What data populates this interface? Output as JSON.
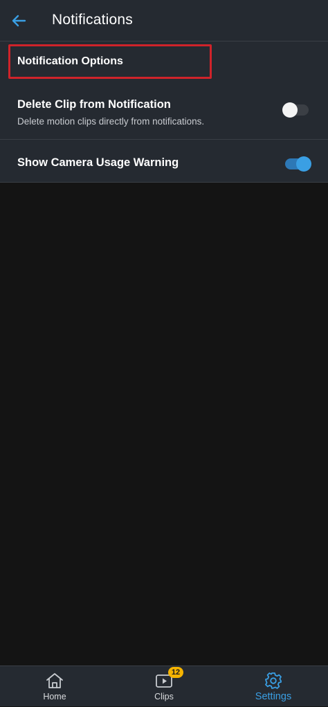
{
  "app_bar": {
    "title": "Notifications",
    "back_icon": "arrow-left-icon",
    "accent_color": "#3a9fe4"
  },
  "section": {
    "header": "Notification Options",
    "highlight_color": "#d0232a"
  },
  "settings": [
    {
      "title": "Delete Clip from Notification",
      "subtitle": "Delete motion clips directly from notifications.",
      "enabled": false
    },
    {
      "title": "Show Camera Usage Warning",
      "enabled": true
    }
  ],
  "bottom_nav": {
    "items": [
      {
        "label": "Home",
        "icon": "home-icon",
        "active": false
      },
      {
        "label": "Clips",
        "icon": "play-icon",
        "badge": "12",
        "active": false
      },
      {
        "label": "Settings",
        "icon": "gear-icon",
        "active": true
      }
    ],
    "badge_color": "#f5b301"
  }
}
